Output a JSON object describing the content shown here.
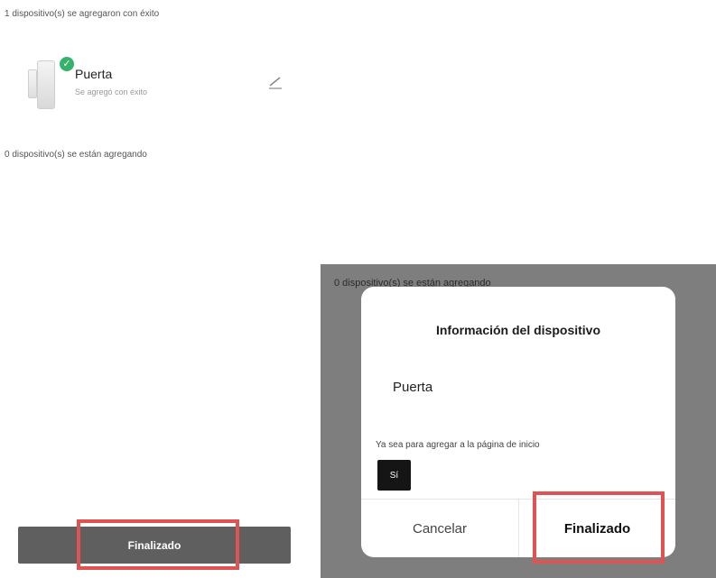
{
  "left_screen": {
    "added_count_text": "1 dispositivo(s) se agregaron con éxito",
    "device": {
      "name": "Puerta",
      "status": "Se agregó con éxito",
      "icon": "door-sensor-icon",
      "badge_icon": "check-icon"
    },
    "adding_count_text": "0 dispositivo(s) se están agregando",
    "finish_label": "Finalizado"
  },
  "right_screen": {
    "background_status_text": "0 dispositivo(s) se están agregando",
    "dialog": {
      "title": "Información del dispositivo",
      "device_name": "Puerta",
      "question": "Ya sea para agregar a la página de inicio",
      "yes_label": "Sí",
      "cancel_label": "Cancelar",
      "finish_label": "Finalizado"
    }
  },
  "colors": {
    "highlight": "#e05353",
    "success": "#35b36b",
    "button_dark": "#5f5f5f",
    "overlay": "#7e7e7e"
  }
}
